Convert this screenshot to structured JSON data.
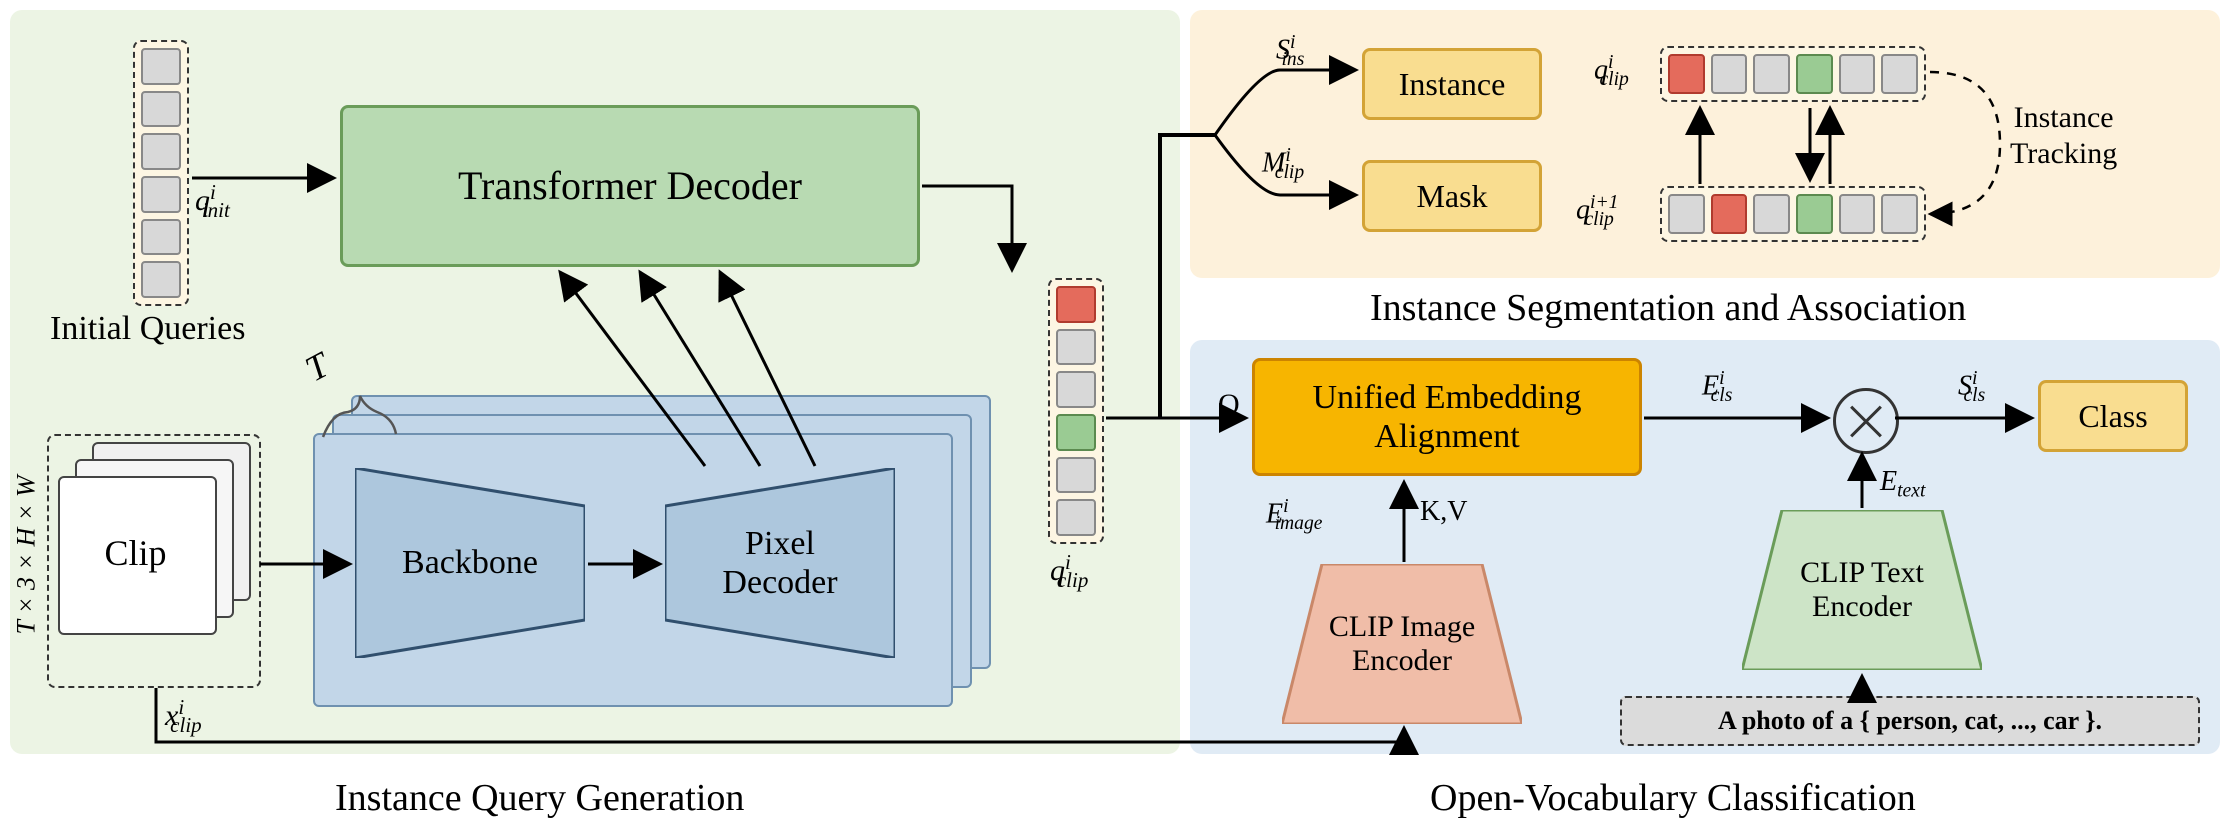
{
  "captions": {
    "left": "Instance Query Generation",
    "right": "Open-Vocabulary Classification",
    "topRight": "Instance Segmentation and Association"
  },
  "blocks": {
    "clip": "Clip",
    "backbone": "Backbone",
    "pixelDecoder": "Pixel\nDecoder",
    "transformerDecoder": "Transformer Decoder",
    "instance": "Instance",
    "mask": "Mask",
    "uea": "Unified Embedding\nAlignment",
    "clipImageEnc": "CLIP Image\nEncoder",
    "clipTextEnc": "CLIP Text\nEncoder",
    "classBox": "Class"
  },
  "labels": {
    "initialQueries": "Initial Queries",
    "xClip": "x^i_clip",
    "qInit": "q^i_init",
    "qClip": "q^i_clip",
    "T": "T",
    "THW": "T × 3 × H × W",
    "Sins": "S^i_ins",
    "Mclip": "M^i_clip",
    "Q": "Q",
    "KV": "K,V",
    "Eimage": "E^i_image",
    "Ecls": "E^i_cls",
    "Etext": "E_text",
    "Scls": "S^i_cls",
    "qClipTop": "q^i_clip",
    "qClipBot": "q^i+1_clip",
    "instTrack": "Instance\nTracking",
    "prompt": "A photo of a { person, cat, ..., car }."
  }
}
